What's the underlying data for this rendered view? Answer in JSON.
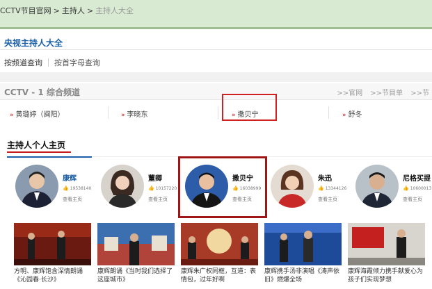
{
  "breadcrumb": {
    "site": "CCTV节目官网",
    "sep": ">",
    "hosts": "主持人",
    "current": "主持人大全"
  },
  "page_title": "央视主持人大全",
  "query_tabs": {
    "by_channel": "按频道查询",
    "by_initial": "按首字母查询"
  },
  "channel": {
    "name": "CCTV - 1 综合频道",
    "links": [
      ">>官网",
      ">>节目单",
      ">>节"
    ],
    "hosts": [
      "黄璐婷（闽阳）",
      "李晓东",
      "撒贝宁",
      "舒冬"
    ]
  },
  "personal_pages": {
    "title": "主持人个人主页",
    "people": [
      {
        "name": "康辉",
        "likes": "19538140",
        "home": "查看主页",
        "color": "#1a5fa8"
      },
      {
        "name": "董卿",
        "likes": "10157220",
        "home": "查看主页",
        "color": "#111111"
      },
      {
        "name": "撒贝宁",
        "likes": "16038999",
        "home": "查看主页",
        "color": "#111111"
      },
      {
        "name": "朱迅",
        "likes": "13344126",
        "home": "查看主页",
        "color": "#111111"
      },
      {
        "name": "尼格买提",
        "likes": "10600013",
        "home": "查看主页",
        "color": "#111111"
      }
    ]
  },
  "videos": [
    {
      "caption": "方明、康辉饱含深情朗诵《沁园春·长沙》"
    },
    {
      "caption": "康辉朗诵《当时我们选择了这座城市》"
    },
    {
      "caption": "康辉朱广权同框，互道：表情包，过年好啊"
    },
    {
      "caption": "康辉携手汤非演唱《涛声依旧》燃爆全场"
    },
    {
      "caption": "康辉海霞倾力携手献爱心为孩子们实现梦想"
    }
  ],
  "colors": {
    "accent_blue": "#1a5fa8",
    "accent_red": "#c41a1a",
    "topbar": "#d9ead3"
  }
}
